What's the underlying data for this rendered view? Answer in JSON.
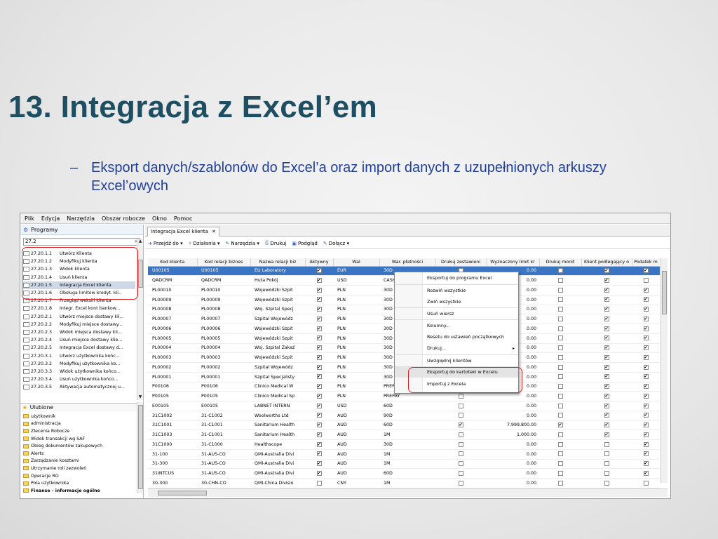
{
  "slide": {
    "title": "13. Integracja z Excel’em",
    "bullet_dash": "–",
    "bullet_text": "Eksport danych/szablonów do Excel’a oraz import danych z uzupełnionych arkuszy Excel’owych"
  },
  "menubar": [
    "Plik",
    "Edycja",
    "Narzędzia",
    "Obszar robocze",
    "Okno",
    "Pomoc"
  ],
  "left_panel": {
    "header": "Programy",
    "search_value": "27.2",
    "programs": [
      {
        "code": "27.20.1.1",
        "name": "Utwórz Klienta"
      },
      {
        "code": "27.20.1.2",
        "name": "Modyfikuj klienta"
      },
      {
        "code": "27.20.1.3",
        "name": "Widok klienta"
      },
      {
        "code": "27.20.1.4",
        "name": "Usuń klienta"
      },
      {
        "code": "27.20.1.5",
        "name": "Integracja Excel klienta",
        "selected": true
      },
      {
        "code": "27.20.1.6",
        "name": "Obsługa limitów kredyt. kli.."
      },
      {
        "code": "27.20.1.7",
        "name": "Przegląd wekslil klienta"
      },
      {
        "code": "27.20.1.8",
        "name": "Integr. Excel kont bankow..."
      },
      {
        "code": "27.20.2.1",
        "name": "Utwórz miejsce dostawy kli..."
      },
      {
        "code": "27.20.2.2",
        "name": "Modyfikuj miejsce dostawy..."
      },
      {
        "code": "27.20.2.3",
        "name": "Widok miejsca dostawy kli..."
      },
      {
        "code": "27.20.2.4",
        "name": "Usuń miejsce dostawy klie..."
      },
      {
        "code": "27.20.2.5",
        "name": "Integracja Excel dostawy d..."
      },
      {
        "code": "27.20.3.1",
        "name": "Utwórz użytkownika końc..."
      },
      {
        "code": "27.20.3.2",
        "name": "Modyfikuj użytkownika ko..."
      },
      {
        "code": "27.20.3.3",
        "name": "Widok użytkownika końco..."
      },
      {
        "code": "27.20.3.4",
        "name": "Usuń użytkownika końco..."
      },
      {
        "code": "27.20.3.5",
        "name": "Aktywacja automatycznej u..."
      }
    ],
    "favorites_header": "Ulubione",
    "favorites": [
      {
        "label": "użytkownik",
        "bold": false
      },
      {
        "label": "administracja",
        "bold": false
      },
      {
        "label": "Zlecenia Robocze",
        "bold": false
      },
      {
        "label": "Widok transakcji wg SAF",
        "bold": false
      },
      {
        "label": "Obieg dokumentów zakupowych",
        "bold": false
      },
      {
        "label": "Alerts",
        "bold": false
      },
      {
        "label": "Zarządzanie kosztami",
        "bold": false
      },
      {
        "label": "Utrzymanie roli zezwoleń",
        "bold": false
      },
      {
        "label": "Operacje RO",
        "bold": false
      },
      {
        "label": "Pola użytkownika",
        "bold": false
      },
      {
        "label": "Finanse - informacje ogólne",
        "bold": true
      }
    ]
  },
  "tab": {
    "label": "Integracja Excel klienta",
    "close": "✕"
  },
  "toolbar": [
    "Przejdź do ▾",
    "Działania ▾",
    "Narzędzia ▾",
    "Drukuj",
    "Podgląd",
    "Dołącz ▾"
  ],
  "grid": {
    "columns": [
      "Kod klienta",
      "Kod relacji biznes",
      "Nazwa relacji biz",
      "Aktywny",
      "Wal",
      "War. płatności",
      "Drukuj zestawieni",
      "Wyznaczony limit kr",
      "Drukuj monit",
      "Klient podlegający o",
      "Podatek m"
    ],
    "rows": [
      {
        "kod": "U00105",
        "rel": "U00105",
        "nazwa": "EU Laboratory",
        "akt": true,
        "wal": "EUR",
        "war": "30D",
        "druk": false,
        "limit": "0.00",
        "monit": false,
        "podl": true,
        "pod": true,
        "selected": true
      },
      {
        "kod": "QADCRM",
        "rel": "QADCRM",
        "nazwa": "Huta Pokój",
        "akt": true,
        "wal": "USD",
        "war": "CASH",
        "druk": false,
        "limit": "0.00",
        "monit": false,
        "podl": true,
        "pod": false
      },
      {
        "kod": "PL00010",
        "rel": "PL00010",
        "nazwa": "Wojewódzki Szpit",
        "akt": true,
        "wal": "PLN",
        "war": "30D",
        "druk": false,
        "limit": "0.00",
        "monit": false,
        "podl": true,
        "pod": true
      },
      {
        "kod": "PL00009",
        "rel": "PL00009",
        "nazwa": "Wojewódzki Szpit",
        "akt": true,
        "wal": "PLN",
        "war": "30D",
        "druk": false,
        "limit": "0.00",
        "monit": false,
        "podl": true,
        "pod": true
      },
      {
        "kod": "PL00008",
        "rel": "PL00008",
        "nazwa": "Woj. Szpital Specj",
        "akt": true,
        "wal": "PLN",
        "war": "30D",
        "druk": false,
        "limit": "0.00",
        "monit": false,
        "podl": true,
        "pod": true
      },
      {
        "kod": "PL00007",
        "rel": "PL00007",
        "nazwa": "Szpital Wojewódz",
        "akt": true,
        "wal": "PLN",
        "war": "30D",
        "druk": false,
        "limit": "0.00",
        "monit": false,
        "podl": true,
        "pod": true
      },
      {
        "kod": "PL00006",
        "rel": "PL00006",
        "nazwa": "Wojewódzki Szpit",
        "akt": true,
        "wal": "PLN",
        "war": "30D",
        "druk": false,
        "limit": "0.00",
        "monit": false,
        "podl": true,
        "pod": true
      },
      {
        "kod": "PL00005",
        "rel": "PL00005",
        "nazwa": "Wojewódzki Szpit",
        "akt": true,
        "wal": "PLN",
        "war": "30D",
        "druk": false,
        "limit": "0.00",
        "monit": false,
        "podl": true,
        "pod": true
      },
      {
        "kod": "PL00004",
        "rel": "PL00004",
        "nazwa": "Woj. Szpital Zakaź",
        "akt": true,
        "wal": "PLN",
        "war": "30D",
        "druk": false,
        "limit": "0.00",
        "monit": false,
        "podl": true,
        "pod": true
      },
      {
        "kod": "PL00003",
        "rel": "PL00003",
        "nazwa": "Wojewódzki Szpit",
        "akt": true,
        "wal": "PLN",
        "war": "30D",
        "druk": false,
        "limit": "0.00",
        "monit": false,
        "podl": true,
        "pod": true
      },
      {
        "kod": "PL00002",
        "rel": "PL00002",
        "nazwa": "Szpital Wojewódz",
        "akt": true,
        "wal": "PLN",
        "war": "30D",
        "druk": false,
        "limit": "0.00",
        "monit": false,
        "podl": true,
        "pod": true
      },
      {
        "kod": "PL00001",
        "rel": "PL00001",
        "nazwa": "Szpital Specjalisty",
        "akt": true,
        "wal": "PLN",
        "war": "30D",
        "druk": false,
        "limit": "0.00",
        "monit": false,
        "podl": true,
        "pod": true
      },
      {
        "kod": "P00106",
        "rel": "P00106",
        "nazwa": "Clinico Medical W",
        "akt": true,
        "wal": "PLN",
        "war": "PREPAY",
        "druk": false,
        "limit": "0.00",
        "monit": false,
        "podl": true,
        "pod": true
      },
      {
        "kod": "P00105",
        "rel": "P00105",
        "nazwa": "Clinico Medical Sp",
        "akt": true,
        "wal": "PLN",
        "war": "PREPAY",
        "druk": false,
        "limit": "0.00",
        "monit": false,
        "podl": true,
        "pod": true
      },
      {
        "kod": "E00105",
        "rel": "E00105",
        "nazwa": "LABNET INTERN",
        "akt": true,
        "wal": "USD",
        "war": "60D",
        "druk": false,
        "limit": "0.00",
        "monit": false,
        "podl": true,
        "pod": true
      },
      {
        "kod": "31C1002",
        "rel": "31-C1002",
        "nazwa": "Woolworths Ltd",
        "akt": true,
        "wal": "AUD",
        "war": "90D",
        "druk": false,
        "limit": "0.00",
        "monit": false,
        "podl": true,
        "pod": true
      },
      {
        "kod": "31C1001",
        "rel": "31-C1001",
        "nazwa": "Sanitarium Health",
        "akt": true,
        "wal": "AUD",
        "war": "60D",
        "druk": true,
        "limit": "7,999,800.00",
        "monit": true,
        "podl": true,
        "pod": true
      },
      {
        "kod": "31C1003",
        "rel": "31-C1001",
        "nazwa": "Sanitarium Health",
        "akt": true,
        "wal": "AUD",
        "war": "1M",
        "druk": false,
        "limit": "1,000.00",
        "monit": false,
        "podl": true,
        "pod": true
      },
      {
        "kod": "31C1000",
        "rel": "31-C1000",
        "nazwa": "Healthscope",
        "akt": true,
        "wal": "AUD",
        "war": "30D",
        "druk": false,
        "limit": "0.00",
        "monit": false,
        "podl": false,
        "pod": true
      },
      {
        "kod": "31-100",
        "rel": "31-AUS-CO",
        "nazwa": "QMI-Australia Divi",
        "akt": true,
        "wal": "AUD",
        "war": "1M",
        "druk": false,
        "limit": "0.00",
        "monit": false,
        "podl": false,
        "pod": true
      },
      {
        "kod": "31-300",
        "rel": "31-AUS-CO",
        "nazwa": "QMI-Australia Divi",
        "akt": true,
        "wal": "AUD",
        "war": "1M",
        "druk": false,
        "limit": "0.00",
        "monit": false,
        "podl": false,
        "pod": true
      },
      {
        "kod": "31INTCUS",
        "rel": "31-AUS-CO",
        "nazwa": "QMI-Australia Divi",
        "akt": true,
        "wal": "AUD",
        "war": "60D",
        "druk": false,
        "limit": "0.00",
        "monit": false,
        "podl": false,
        "pod": true
      },
      {
        "kod": "30-300",
        "rel": "30-CHN-CO",
        "nazwa": "QMI-China Divisio",
        "akt": false,
        "wal": "CNY",
        "war": "1M",
        "druk": false,
        "limit": "0.00",
        "monit": false,
        "podl": false,
        "pod": false
      }
    ]
  },
  "context_menu": [
    {
      "label": "Eksportuj do programu Excel"
    },
    {
      "label": "Rozwiń wszystkie",
      "sep": true
    },
    {
      "label": "Zwiń wszystkie"
    },
    {
      "label": "Usuń wiersz",
      "sep": true
    },
    {
      "label": "Kolumny...",
      "sep": true
    },
    {
      "label": "Resetu do ustawień początkowych"
    },
    {
      "label": "Drukuj...",
      "arrow": "▸"
    },
    {
      "label": "Uwzględnij klientów",
      "sep": true
    },
    {
      "label": "Eksportuj do kartoteki w Excelu",
      "sep": true,
      "hl": true
    },
    {
      "label": "Importuj z Excela"
    }
  ],
  "colors": {
    "title": "#1e4e62",
    "bullet": "#1f3f9a",
    "highlight_box": "#e02020",
    "row_selected": "#3a75c4"
  }
}
